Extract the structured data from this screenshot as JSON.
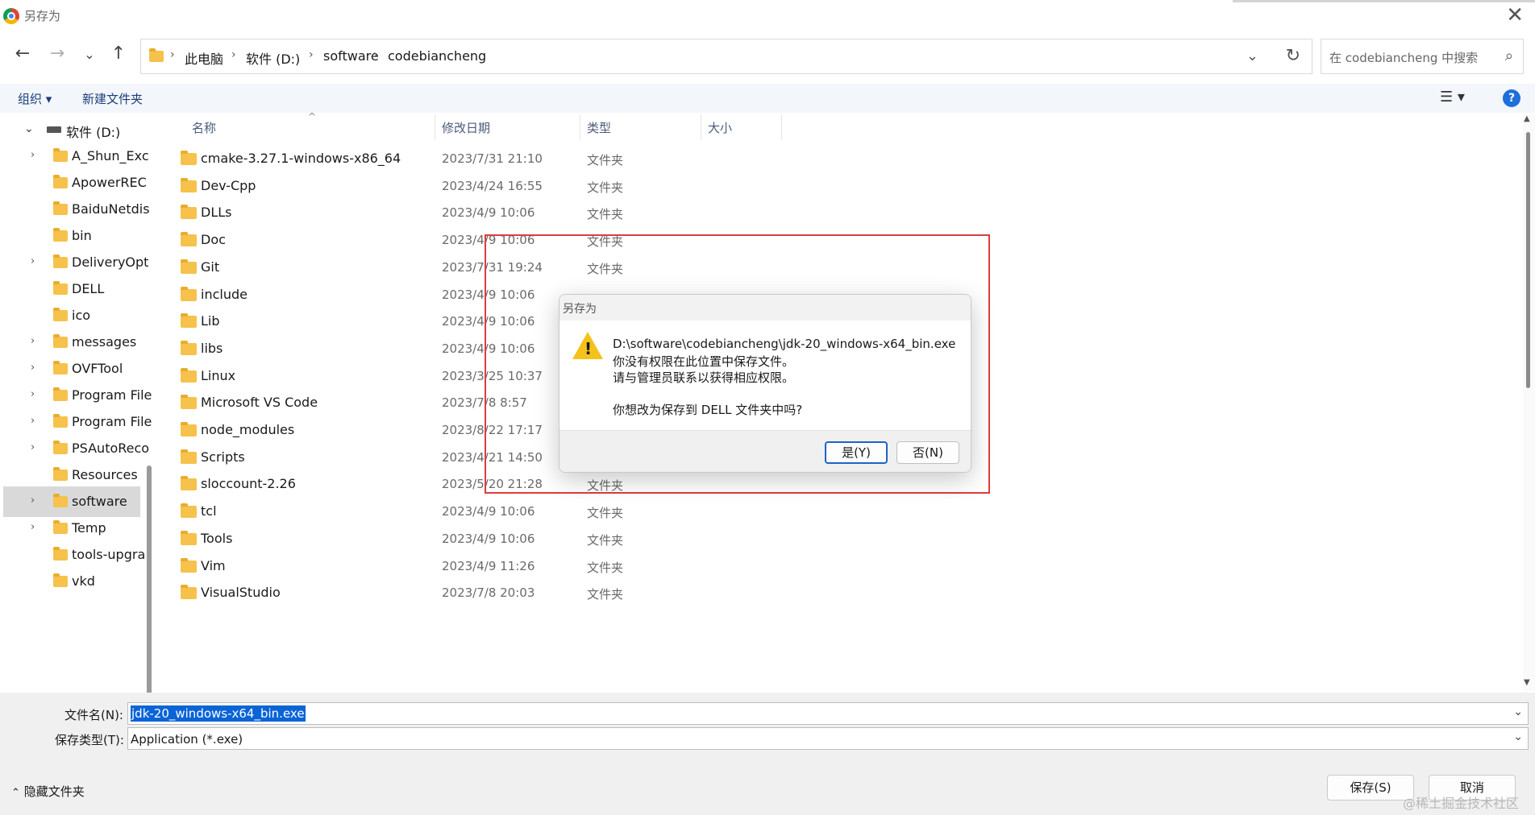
{
  "window": {
    "title": "另存为"
  },
  "nav": {
    "breadcrumb": [
      "此电脑",
      "软件 (D:)",
      "software",
      "codebiancheng"
    ],
    "search_placeholder": "在 codebiancheng 中搜索"
  },
  "toolbar": {
    "organize": "组织 ▾",
    "new_folder": "新建文件夹",
    "help": "?"
  },
  "tree": {
    "drive": "软件 (D:)",
    "items": [
      {
        "label": "A_Shun_Exc",
        "expandable": true
      },
      {
        "label": "ApowerREC",
        "expandable": false
      },
      {
        "label": "BaiduNetdis",
        "expandable": false
      },
      {
        "label": "bin",
        "expandable": false
      },
      {
        "label": "DeliveryOpt",
        "expandable": true
      },
      {
        "label": "DELL",
        "expandable": false
      },
      {
        "label": "ico",
        "expandable": false
      },
      {
        "label": "messages",
        "expandable": true
      },
      {
        "label": "OVFTool",
        "expandable": true
      },
      {
        "label": "Program File",
        "expandable": true
      },
      {
        "label": "Program File",
        "expandable": true
      },
      {
        "label": "PSAutoReco",
        "expandable": true
      },
      {
        "label": "Resources",
        "expandable": false
      },
      {
        "label": "software",
        "expandable": true,
        "selected": true
      },
      {
        "label": "Temp",
        "expandable": true
      },
      {
        "label": "tools-upgra",
        "expandable": false
      },
      {
        "label": "vkd",
        "expandable": false
      }
    ]
  },
  "columns": {
    "name": "名称",
    "modified": "修改日期",
    "type": "类型",
    "size": "大小"
  },
  "files": [
    {
      "name": "cmake-3.27.1-windows-x86_64",
      "date": "2023/7/31 21:10",
      "type": "文件夹"
    },
    {
      "name": "Dev-Cpp",
      "date": "2023/4/24 16:55",
      "type": "文件夹"
    },
    {
      "name": "DLLs",
      "date": "2023/4/9 10:06",
      "type": "文件夹"
    },
    {
      "name": "Doc",
      "date": "2023/4/9 10:06",
      "type": "文件夹"
    },
    {
      "name": "Git",
      "date": "2023/7/31 19:24",
      "type": "文件夹"
    },
    {
      "name": "include",
      "date": "2023/4/9 10:06",
      "type": ""
    },
    {
      "name": "Lib",
      "date": "2023/4/9 10:06",
      "type": ""
    },
    {
      "name": "libs",
      "date": "2023/4/9 10:06",
      "type": ""
    },
    {
      "name": "Linux",
      "date": "2023/3/25 10:37",
      "type": ""
    },
    {
      "name": "Microsoft VS Code",
      "date": "2023/7/8 8:57",
      "type": ""
    },
    {
      "name": "node_modules",
      "date": "2023/8/22 17:17",
      "type": "文件夹"
    },
    {
      "name": "Scripts",
      "date": "2023/4/21 14:50",
      "type": "文件夹"
    },
    {
      "name": "sloccount-2.26",
      "date": "2023/5/20 21:28",
      "type": "文件夹"
    },
    {
      "name": "tcl",
      "date": "2023/4/9 10:06",
      "type": "文件夹"
    },
    {
      "name": "Tools",
      "date": "2023/4/9 10:06",
      "type": "文件夹"
    },
    {
      "name": "Vim",
      "date": "2023/4/9 11:26",
      "type": "文件夹"
    },
    {
      "name": "VisualStudio",
      "date": "2023/7/8 20:03",
      "type": "文件夹"
    }
  ],
  "bottom": {
    "filename_label": "文件名(N):",
    "filename_value": "jdk-20_windows-x64_bin.exe",
    "filetype_label": "保存类型(T):",
    "filetype_value": "Application (*.exe)",
    "hide_folders": "隐藏文件夹",
    "save_button": "保存(S)",
    "cancel_button": "取消",
    "watermark": "@稀土掘金技术社区"
  },
  "modal": {
    "title": "另存为",
    "line1": "D:\\software\\codebiancheng\\jdk-20_windows-x64_bin.exe",
    "line2": "你没有权限在此位置中保存文件。",
    "line3": "请与管理员联系以获得相应权限。",
    "line4": "你想改为保存到 DELL 文件夹中吗?",
    "yes_button": "是(Y)",
    "no_button": "否(N)"
  },
  "colors": {
    "highlight": "#e03c3c",
    "selection": "#0a64d6",
    "folder": "#f6c24b"
  }
}
